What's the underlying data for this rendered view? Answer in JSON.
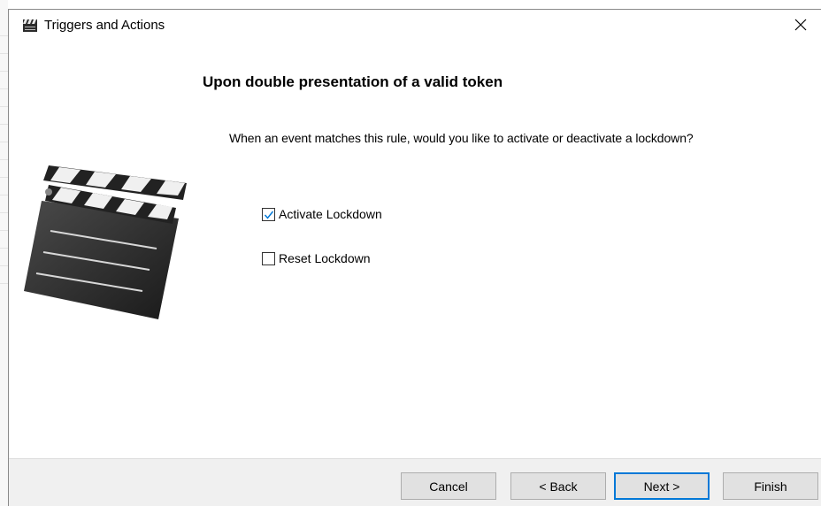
{
  "window": {
    "title": "Triggers and Actions",
    "close_glyph": "✕"
  },
  "page": {
    "heading": "Upon double presentation of a valid token",
    "question": "When an event matches this rule, would you like to activate or deactivate a lockdown?",
    "illustration_icon": "clapperboard-icon"
  },
  "options": [
    {
      "label": "Activate Lockdown",
      "checked": true
    },
    {
      "label": "Reset Lockdown",
      "checked": false
    }
  ],
  "buttons": {
    "cancel": "Cancel",
    "back": "< Back",
    "next": "Next >",
    "finish": "Finish"
  },
  "colors": {
    "accent": "#0078d7",
    "footer_bg": "#f0f0f0",
    "button_bg": "#e1e1e1"
  }
}
